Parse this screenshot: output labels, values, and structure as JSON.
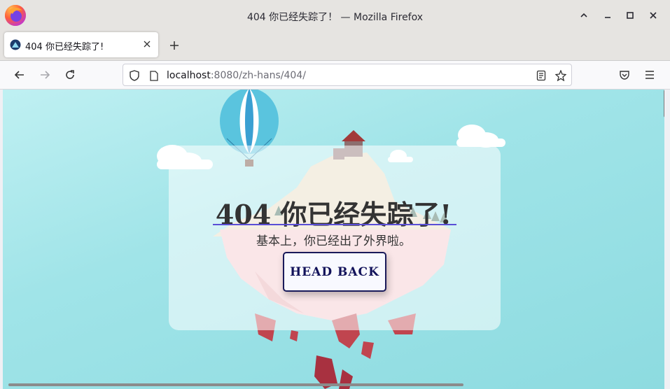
{
  "window": {
    "title": "404 你已经失踪了！ — Mozilla Firefox"
  },
  "tab": {
    "title": "404 你已经失踪了!"
  },
  "url": {
    "host": "localhost",
    "rest": ":8080/zh-hans/404/"
  },
  "page": {
    "heading": "404 你已经失踪了!",
    "subheading": "基本上，你已经出了外界啦。",
    "button_label": "HEAD BACK"
  },
  "colors": {
    "sky_top": "#bff0f2",
    "sky_bottom": "#8ddbe0",
    "button_border": "#1a1a5a",
    "underline": "#5a4fd6"
  },
  "icons": {
    "firefox_logo": "firefox-logo-icon",
    "minimize": "minimize-icon",
    "maximize": "maximize-icon",
    "close": "close-icon",
    "chevron_up": "chevron-up-icon",
    "back": "back-arrow-icon",
    "forward": "forward-arrow-icon",
    "reload": "reload-icon",
    "shield": "shield-icon",
    "page": "page-icon",
    "reader": "reader-view-icon",
    "bookmark": "star-icon",
    "pocket": "pocket-icon",
    "menu": "hamburger-menu-icon"
  }
}
